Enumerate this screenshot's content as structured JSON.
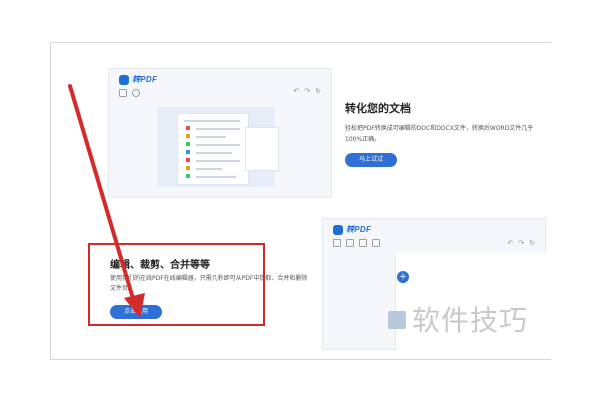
{
  "top_mock": {
    "logo_text": "转PDF"
  },
  "bottom_mock": {
    "logo_text": "转PDF",
    "plus_label": "+"
  },
  "convert": {
    "title": "转化您的文档",
    "description": "轻松把PDF转换成可编辑的DOC和DOCX文件，转换后WORD文件几乎100%正确。",
    "button_label": "马上试试"
  },
  "edit": {
    "title": "编辑、裁剪、合并等等",
    "description": "使用我们的在线PDF在线编辑器，只需几秒即可从PDF中提取、合并和删除文件页。",
    "button_label": "点击使用"
  },
  "watermark": {
    "text": "软件技巧"
  },
  "colors": {
    "accent": "#2f6fd6",
    "highlight_red": "#d52a2a"
  }
}
